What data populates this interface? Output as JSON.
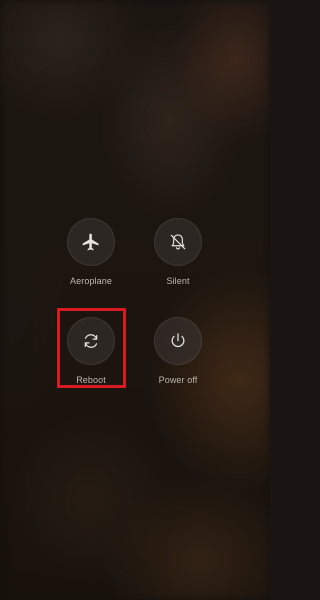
{
  "power_menu": {
    "aeroplane": {
      "label": "Aeroplane",
      "icon": "airplane-icon"
    },
    "silent": {
      "label": "Silent",
      "icon": "bell-off-icon"
    },
    "reboot": {
      "label": "Reboot",
      "icon": "reboot-icon"
    },
    "power_off": {
      "label": "Power off",
      "icon": "power-icon"
    }
  },
  "highlight": {
    "color": "#d81b23",
    "target": "reboot"
  }
}
